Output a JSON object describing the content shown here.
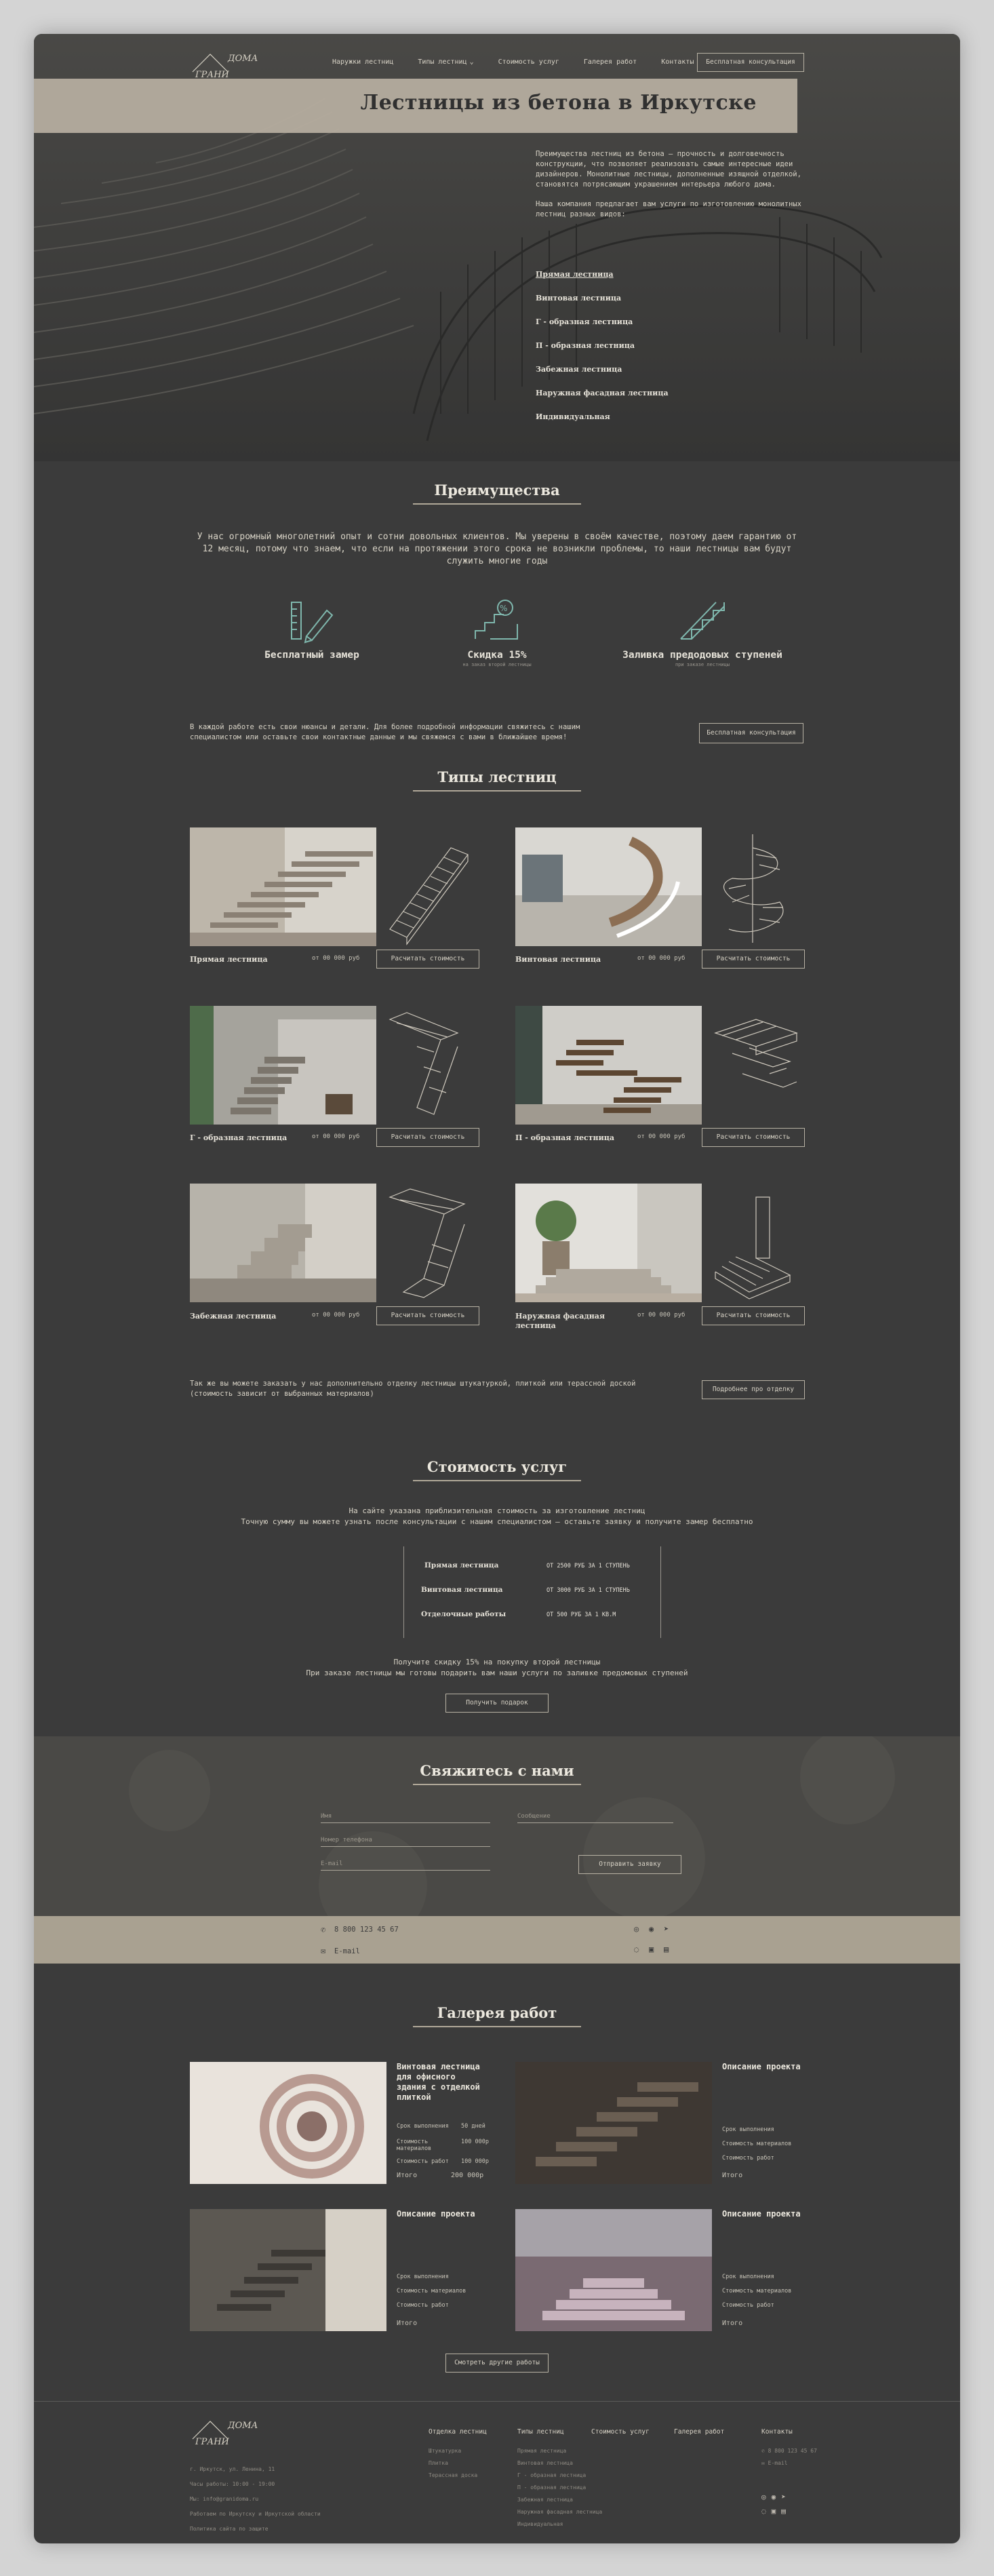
{
  "brand": {
    "logo_text": "ГРАНИ ДОМА"
  },
  "nav": {
    "items": [
      "Наружки лестниц",
      "Типы лестниц",
      "Стоимость услуг",
      "Галерея работ",
      "Контакты"
    ],
    "cta": "Бесплатная консультация"
  },
  "hero": {
    "title": "Лестницы из бетона в Иркутске",
    "p1": "Преимущества лестниц из бетона – прочность и долговечность конструкции, что позволяет реализовать самые интересные идеи дизайнеров. Монолитные лестницы, дополненные изящной отделкой, становятся потрясающим украшением интерьера любого дома.",
    "p2": "Наша компания предлагает вам услуги по изготовлению монолитных лестниц разных видов:",
    "types": [
      "Прямая лестница",
      "Винтовая лестница",
      "Г - образная лестница",
      "П - образная лестница",
      "Забежная лестница",
      "Наружная фасадная лестница",
      "Индивидуальная"
    ]
  },
  "advantages": {
    "title": "Преимущества",
    "text": "У нас огромный многолетний опыт и сотни довольных клиентов. Мы уверены в своём качестве, поэтому даем гарантию от 12 месяц, потому что знаем, что если на протяжении этого срока не возникли проблемы, то наши лестницы вам будут служить многие годы",
    "items": [
      {
        "icon": "ruler-pencil-icon",
        "title": "Бесплатный замер",
        "sub": ""
      },
      {
        "icon": "discount-stairs-icon",
        "title": "Скидка 15%",
        "sub": "на заказ второй лестницы"
      },
      {
        "icon": "stairs-icon",
        "title": "Заливка предодовых ступеней",
        "sub": "при заказе лестницы"
      }
    ],
    "note": "В каждой работе есть свои нюансы и детали. Для более подробной информации свяжитесь с нашим специалистом или оставьте свои контактные данные и мы свяжемся с вами в ближайшее время!",
    "cta": "Бесплатная консультация"
  },
  "types": {
    "title": "Типы лестниц",
    "price": "от 00 000 руб",
    "button": "Расчитать стоимость",
    "cards": [
      {
        "name": "Прямая лестница"
      },
      {
        "name": "Винтовая лестница"
      },
      {
        "name": "Г - образная лестница"
      },
      {
        "name": "П - образная лестница"
      },
      {
        "name": "Забежная лестница"
      },
      {
        "name": "Наружная фасадная лестница"
      }
    ],
    "note": "Так же вы можете заказать у нас дополнительно отделку лестницы штукатуркой, плиткой или терассной доской (стоимость зависит от выбранных материалов)",
    "note_cta": "Подробнее про отделку"
  },
  "pricing": {
    "title": "Стоимость услуг",
    "intro1": "На сайте указана приблизительная стоимость за изготовление лестниц",
    "intro2": "Точную сумму вы можете узнать после консультации с нашим специалистом – оставьте заявку и получите замер бесплатно",
    "rows": [
      {
        "name": "Прямая лестница",
        "price": "ОТ 2500 РУБ ЗА 1 СТУПЕНЬ"
      },
      {
        "name": "Винтовая лестница",
        "price": "ОТ 3000 РУБ ЗА 1 СТУПЕНЬ"
      },
      {
        "name": "Отделочные работы",
        "price": "ОТ 500 РУБ ЗА 1 КВ.М"
      }
    ],
    "promo1": "Получите скидку 15% на покупку второй лестницы",
    "promo2": "При заказе лестницы мы готовы подарить вам наши услуги по заливке предомовых ступеней",
    "cta": "Получить подарок"
  },
  "contact": {
    "title": "Свяжитесь с нами",
    "f_name": "Имя",
    "f_question": "Сообщение",
    "f_phone": "Номер телефона",
    "f_email": "E-mail",
    "submit": "Отправить заявку",
    "phone": "8 800 123 45 67",
    "email": "E-mail"
  },
  "gallery": {
    "title": "Галерея работ",
    "items": [
      {
        "title": "Винтовая лестница для офисного здания с отделкой плиткой",
        "term": "Срок выполнения",
        "term_v": "50 дней",
        "mat": "Стоимость материалов",
        "mat_v": "100 000р",
        "work": "Стоимость работ",
        "work_v": "100 000р",
        "total": "Итого",
        "total_v": "200 000р"
      },
      {
        "title": "Описание проекта",
        "term": "Срок выполнения",
        "term_v": "",
        "mat": "Стоимость материалов",
        "mat_v": "",
        "work": "Стоимость работ",
        "work_v": "",
        "total": "Итого",
        "total_v": ""
      },
      {
        "title": "Описание проекта",
        "term": "Срок выполнения",
        "term_v": "",
        "mat": "Стоимость материалов",
        "mat_v": "",
        "work": "Стоимость работ",
        "work_v": "",
        "total": "Итого",
        "total_v": ""
      },
      {
        "title": "Описание проекта",
        "term": "Срок выполнения",
        "term_v": "",
        "mat": "Стоимость материалов",
        "mat_v": "",
        "work": "Стоимость работ",
        "work_v": "",
        "total": "Итого",
        "total_v": ""
      }
    ],
    "cta": "Смотреть другие работы"
  },
  "footer": {
    "address": "г. Иркутск, ул. Ленина, 11",
    "hours": "Часы работы: 10:00 - 19:00",
    "mail": "Мы: info@granidoma.ru",
    "area": "Работаем по Иркутску и Иркутской области",
    "policy": "Политика сайта по защите",
    "col1": {
      "h": "Отделка лестниц",
      "items": [
        "Штукатурка",
        "Плитка",
        "Терассная доска"
      ]
    },
    "col2": {
      "h": "Типы лестниц",
      "items": [
        "Прямая лестница",
        "Винтовая лестница",
        "Г - образная лестница",
        "П - образная лестница",
        "Забежная лестница",
        "Наружная фасадная лестница",
        "Индивидуальная"
      ]
    },
    "col3": {
      "h": "Стоимость услуг"
    },
    "col4": {
      "h": "Галерея работ"
    },
    "col5": {
      "h": "Контакты",
      "phone": "8 800 123 45 67",
      "email": "E-mail"
    }
  },
  "colors": {
    "bg": "#3b3b3b",
    "beige": "#b8b0a2",
    "text": "#e6e2d8",
    "accent": "#7fb7ad"
  }
}
